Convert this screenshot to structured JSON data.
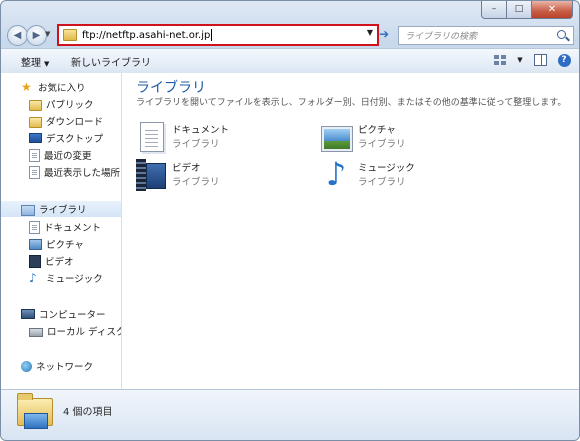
{
  "window": {
    "caption_buttons": {
      "minimize": "–",
      "maximize": "□",
      "close": "✕"
    }
  },
  "navbar": {
    "back_glyph": "◀",
    "forward_glyph": "▶",
    "address_value": "ftp://netftp.asahi-net.or.jp",
    "go_glyph": "➔",
    "search_placeholder": "ライブラリの検索"
  },
  "commandbar": {
    "organize": "整理",
    "new_library": "新しいライブラリ"
  },
  "sidebar": {
    "favorites": {
      "label": "お気に入り",
      "items": [
        "パブリック",
        "ダウンロード",
        "デスクトップ",
        "最近の変更",
        "最近表示した場所"
      ]
    },
    "libraries": {
      "label": "ライブラリ",
      "items": [
        "ドキュメント",
        "ピクチャ",
        "ビデオ",
        "ミュージック"
      ]
    },
    "computer": {
      "label": "コンピューター",
      "items": [
        "ローカル ディスク ("
      ]
    },
    "network": {
      "label": "ネットワーク"
    }
  },
  "content": {
    "title": "ライブラリ",
    "description": "ライブラリを開いてファイルを表示し、フォルダー別、日付別、またはその他の基準に従って整理します。",
    "libraries": [
      {
        "name": "ドキュメント",
        "type": "ライブラリ",
        "icon": "documents-library-icon"
      },
      {
        "name": "ピクチャ",
        "type": "ライブラリ",
        "icon": "pictures-library-icon"
      },
      {
        "name": "ビデオ",
        "type": "ライブラリ",
        "icon": "videos-library-icon"
      },
      {
        "name": "ミュージック",
        "type": "ライブラリ",
        "icon": "music-library-icon"
      }
    ]
  },
  "details": {
    "item_count": "4 個の項目"
  },
  "colors": {
    "address_highlight": "#d0121c",
    "title_blue": "#1e5aa8",
    "chrome": "#c9d9ec"
  }
}
